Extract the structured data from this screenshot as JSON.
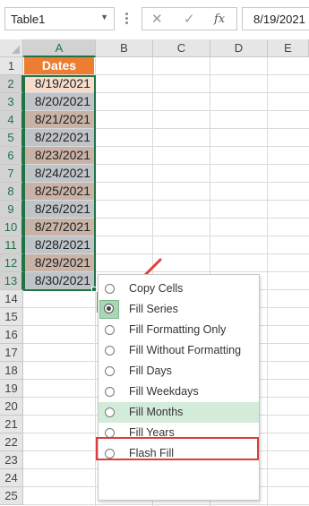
{
  "formula_bar": {
    "name_box": "Table1",
    "cancel_icon": "✕",
    "enter_icon": "✓",
    "fx_label": "fx",
    "value": "8/19/2021"
  },
  "grid": {
    "columns": [
      "A",
      "B",
      "C",
      "D",
      "E"
    ],
    "rows": [
      "1",
      "2",
      "3",
      "4",
      "5",
      "6",
      "7",
      "8",
      "9",
      "10",
      "11",
      "12",
      "13",
      "14",
      "15",
      "16",
      "17",
      "18",
      "19",
      "20",
      "21",
      "22",
      "23",
      "24",
      "25"
    ],
    "header_cell": "Dates",
    "dates": [
      "8/19/2021",
      "8/20/2021",
      "8/21/2021",
      "8/22/2021",
      "8/23/2021",
      "8/24/2021",
      "8/25/2021",
      "8/26/2021",
      "8/27/2021",
      "8/28/2021",
      "8/29/2021",
      "8/30/2021"
    ]
  },
  "colors": {
    "header_fill": "#ed7d31",
    "tan_fill": "#c9b2a6",
    "gray_fill": "#bfc4c8",
    "first_fill": "#f8dccb",
    "selection": "#217346",
    "highlight": "#e03c3c"
  },
  "auto_fill_button": {
    "icon": "auto-fill-options-icon"
  },
  "menu": {
    "items": [
      {
        "label": "Copy Cells"
      },
      {
        "label": "Fill Series"
      },
      {
        "label": "Fill Formatting Only"
      },
      {
        "label": "Fill Without Formatting"
      },
      {
        "label": "Fill Days"
      },
      {
        "label": "Fill Weekdays"
      },
      {
        "label": "Fill Months"
      },
      {
        "label": "Fill Years"
      },
      {
        "label": "Flash Fill"
      }
    ],
    "selected": "Fill Series",
    "highlighted": "Fill Months"
  }
}
